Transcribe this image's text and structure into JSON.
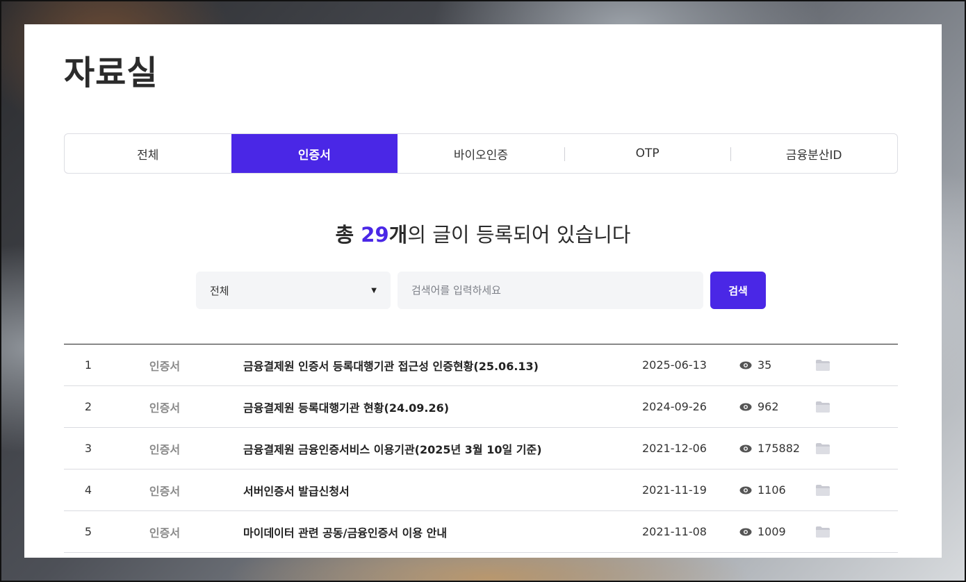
{
  "page": {
    "title": "자료실"
  },
  "tabs": [
    {
      "label": "전체"
    },
    {
      "label": "인증서"
    },
    {
      "label": "바이오인증"
    },
    {
      "label": "OTP"
    },
    {
      "label": "금융분산ID"
    }
  ],
  "summary": {
    "prefix": "총 ",
    "count": "29",
    "count_unit": "개",
    "suffix": "의 글이 등록되어 있습니다"
  },
  "search": {
    "category_selected": "전체",
    "placeholder": "검색어를 입력하세요",
    "button_label": "검색"
  },
  "rows": [
    {
      "no": "1",
      "category": "인증서",
      "title": "금융결제원 인증서 등록대행기관 접근성 인증현황(25.06.13)",
      "date": "2025-06-13",
      "views": "35"
    },
    {
      "no": "2",
      "category": "인증서",
      "title": "금융결제원 등록대행기관 현황(24.09.26)",
      "date": "2024-09-26",
      "views": "962"
    },
    {
      "no": "3",
      "category": "인증서",
      "title": "금융결제원 금융인증서비스 이용기관(2025년 3월 10일 기준)",
      "date": "2021-12-06",
      "views": "175882"
    },
    {
      "no": "4",
      "category": "인증서",
      "title": "서버인증서 발급신청서",
      "date": "2021-11-19",
      "views": "1106"
    },
    {
      "no": "5",
      "category": "인증서",
      "title": "마이데이터 관련 공동/금융인증서 이용 안내",
      "date": "2021-11-08",
      "views": "1009"
    }
  ],
  "colors": {
    "accent": "#4a27e6",
    "text": "#333333",
    "muted": "#8a8a8a"
  },
  "icons": {
    "views": "eye-icon",
    "attachment": "folder-icon",
    "select": "caret-down-icon"
  }
}
